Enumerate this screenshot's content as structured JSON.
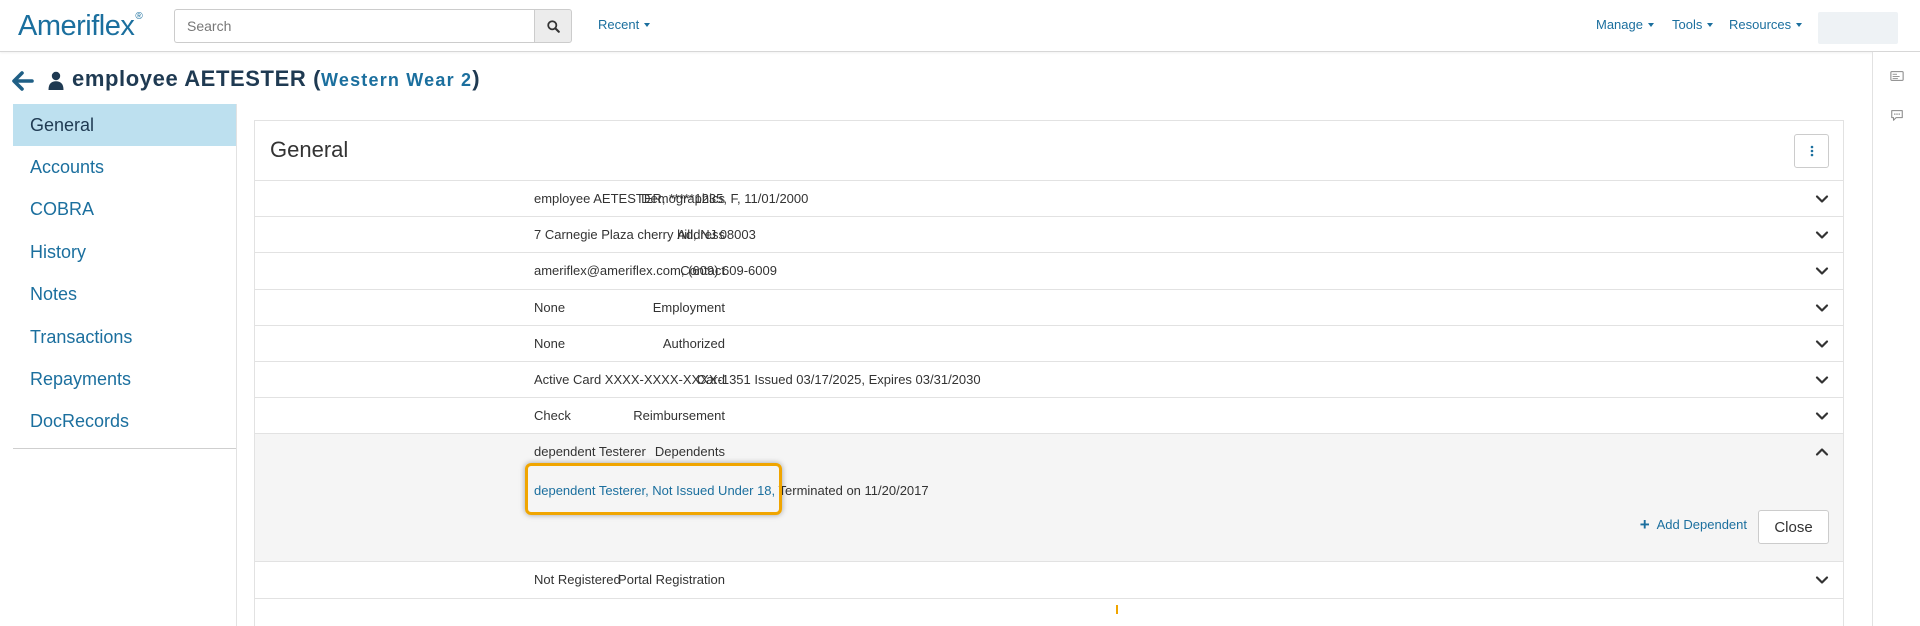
{
  "app": {
    "logo_text": "Ameriflex",
    "logo_mark": "®"
  },
  "search": {
    "placeholder": "Search"
  },
  "navbar": {
    "recent": "Recent",
    "manage": "Manage",
    "tools": "Tools",
    "resources": "Resources"
  },
  "header": {
    "title": "employee AETESTER",
    "open_paren": "(",
    "employer": "Western Wear 2",
    "close_paren": ")"
  },
  "sidebar": {
    "items": [
      {
        "label": "General",
        "active": true
      },
      {
        "label": "Accounts"
      },
      {
        "label": "COBRA"
      },
      {
        "label": "History"
      },
      {
        "label": "Notes"
      },
      {
        "label": "Transactions"
      },
      {
        "label": "Repayments"
      },
      {
        "label": "DocRecords"
      }
    ]
  },
  "panel": {
    "title": "General",
    "rows": [
      {
        "label": "Demographics",
        "value": "employee AETESTER, *****1235, F, 11/01/2000"
      },
      {
        "label": "Address",
        "value": "7 Carnegie Plaza cherry hill, NJ 08003"
      },
      {
        "label": "Contact",
        "value": "ameriflex@ameriflex.com, (609) 609-6009"
      },
      {
        "label": "Employment",
        "value": "None"
      },
      {
        "label": "Authorized",
        "value": "None"
      },
      {
        "label": "Card",
        "value": "Active Card XXXX-XXXX-XXXX-1351 Issued 03/17/2025, Expires 03/31/2030"
      },
      {
        "label": "Reimbursement",
        "value": "Check"
      }
    ],
    "dependents": {
      "label": "Dependents",
      "summary": "dependent Testerer",
      "link_text": "dependent Testerer, Not Issued Under 18,",
      "link_rest": " Terminated on 11/20/2017",
      "add_label": "Add Dependent",
      "close_label": "Close"
    },
    "portal": {
      "label": "Portal Registration",
      "value": "Not Registered"
    }
  },
  "colors": {
    "brand": "#1b6f9e",
    "active_nav": "#bde0ef",
    "highlight": "#f0a500"
  }
}
